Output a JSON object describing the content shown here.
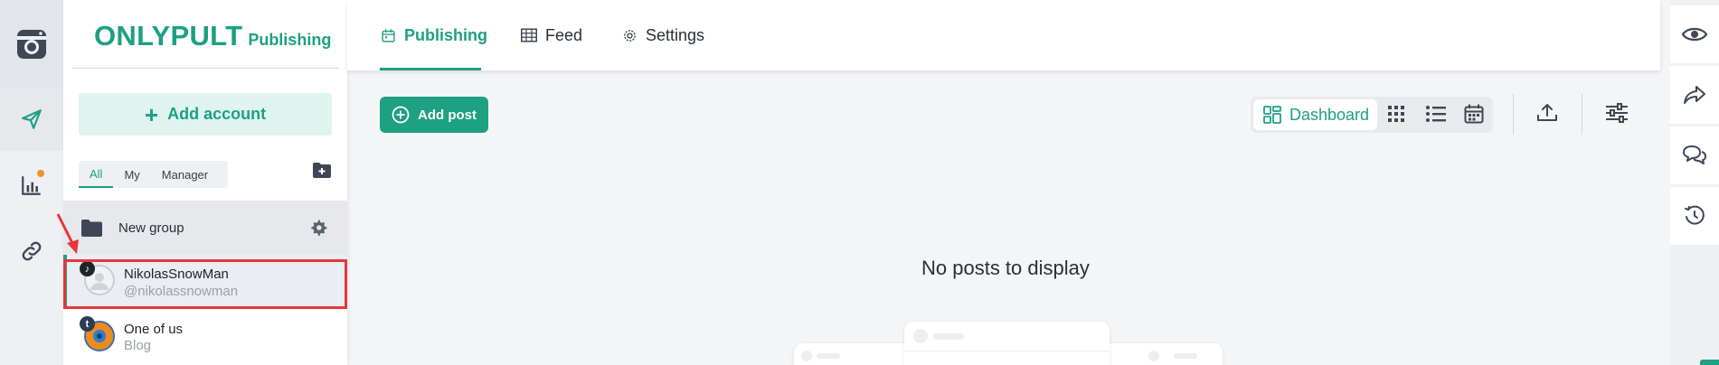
{
  "brand": {
    "name": "ONLYPULT",
    "sub": "Publishing"
  },
  "tabs": [
    {
      "label": "Publishing",
      "icon": "calendar-icon",
      "active": true
    },
    {
      "label": "Feed",
      "icon": "grid-table-icon",
      "active": false
    },
    {
      "label": "Settings",
      "icon": "gear-icon",
      "active": false
    }
  ],
  "sidebar": {
    "add_account": "Add account",
    "filters": [
      "All",
      "My",
      "Manager"
    ],
    "active_filter": "All",
    "group": {
      "name": "New group"
    },
    "accounts": [
      {
        "name": "NikolasSnowMan",
        "handle": "@nikolassnowman",
        "network": "tiktok-badge-icon",
        "selected": true
      },
      {
        "name": "One of us",
        "handle": "Blog",
        "network": "tumblr-badge-icon",
        "badge_letter": "t",
        "selected": false
      }
    ]
  },
  "toolbar": {
    "add_post": "Add post",
    "view_active": "Dashboard"
  },
  "main": {
    "empty_message": "No posts to display"
  },
  "colors": {
    "accent": "#1ea082",
    "highlight": "#e8353a",
    "notification": "#f0932b"
  }
}
